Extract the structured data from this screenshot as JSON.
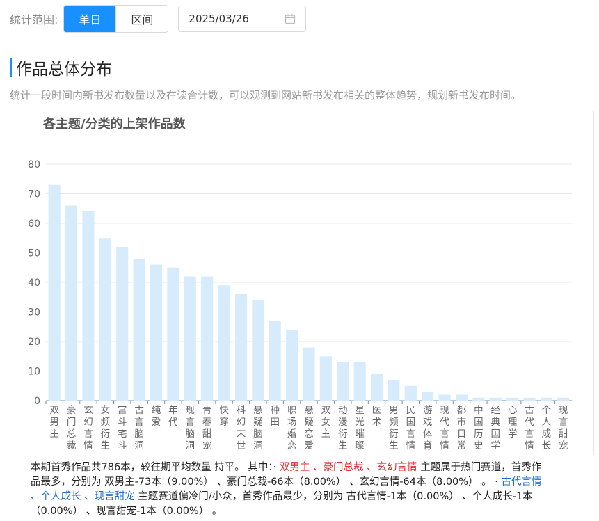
{
  "filter": {
    "label": "统计范围:",
    "options": [
      "单日",
      "区间"
    ],
    "active": "单日",
    "date": "2025/03/26"
  },
  "section": {
    "title": "作品总体分布",
    "description": "统计一段时间内新书发布数量以及在读合计数，可以观测到网站新书发布相关的整体趋势，规划新书发布时间。"
  },
  "colors": {
    "bar": "#d6ebfb",
    "accent": "#1890ff",
    "hot": "#e5262c",
    "cold": "#1f6fd1"
  },
  "chart_data": {
    "type": "bar",
    "title": "各主题/分类的上架作品数",
    "xlabel": "",
    "ylabel": "",
    "ylim": [
      0,
      80
    ],
    "yticks": [
      0,
      10,
      20,
      30,
      40,
      50,
      60,
      70,
      80
    ],
    "grid": true,
    "categories": [
      "双男主",
      "豪门总裁",
      "玄幻言情",
      "女频衍生",
      "宫斗宅斗",
      "古言脑洞",
      "纯爱",
      "年代",
      "现言脑洞",
      "青春甜宠",
      "快穿",
      "科幻末世",
      "悬疑脑洞",
      "种田",
      "职场婚恋",
      "悬疑恋爱",
      "双女主",
      "动漫衍生",
      "星光璀璨",
      "医术",
      "男频衍生",
      "民国言情",
      "游戏体育",
      "现代言情",
      "都市日常",
      "中国历史",
      "经典国学",
      "心理学",
      "古代言情",
      "个人成长",
      "现言甜宠"
    ],
    "values": [
      73,
      66,
      64,
      55,
      52,
      48,
      46,
      45,
      42,
      42,
      39,
      36,
      34,
      27,
      24,
      18,
      15,
      13,
      13,
      9,
      7,
      5,
      3,
      2,
      2,
      1,
      1,
      1,
      1,
      1,
      1
    ]
  },
  "summary": {
    "line1_a": "本期首秀作品共786本，较往期平均数量 持平。 其中：· ",
    "hot_topics": "双男主 、豪门总裁 、玄幻言情",
    "line1_b": " 主题属于热门赛道，首秀作品最多，分别为 双男主-73本（9.00%） 、豪门总裁-66本（8.00%） 、玄幻言情-64本（8.00%） 。 · ",
    "cold_topics": "古代言情 、个人成长 、现言甜宠",
    "line2": " 主题赛道偏冷门/小众，首秀作品最少，分别为 古代言情-1本（0.00%） 、个人成长-1本（0.00%） 、现言甜宠-1本（0.00%） 。"
  }
}
